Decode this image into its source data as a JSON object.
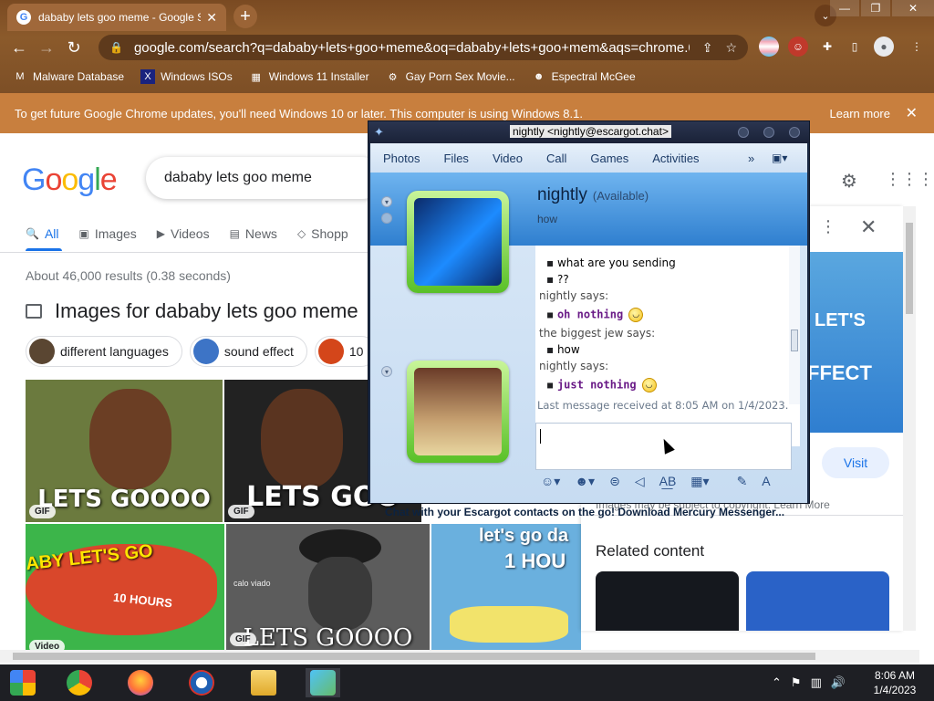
{
  "browser": {
    "tab_title": "dababy lets goo meme - Google Se",
    "url": "google.com/search?q=dababy+lets+goo+meme&oq=dababy+lets+goo+mem&aqs=chrome.0.0i51...",
    "bookmarks": [
      {
        "label": "Malware Database",
        "icon": "M"
      },
      {
        "label": "Windows ISOs",
        "icon": "X"
      },
      {
        "label": "Windows 11 Installer",
        "icon": "▦"
      },
      {
        "label": "Gay Porn Sex Movie...",
        "icon": "⚙"
      },
      {
        "label": "Espectral McGee",
        "icon": "☻"
      }
    ],
    "infobar_text": "To get future Google Chrome updates, you'll need Windows 10 or later. This computer is using Windows 8.1.",
    "infobar_link": "Learn more"
  },
  "google": {
    "logo": [
      "G",
      "o",
      "o",
      "g",
      "l",
      "e"
    ],
    "query": "dababy lets goo meme",
    "tabs": [
      {
        "label": "All",
        "icon": "🔍"
      },
      {
        "label": "Images",
        "icon": "▣"
      },
      {
        "label": "Videos",
        "icon": "▶"
      },
      {
        "label": "News",
        "icon": "▤"
      },
      {
        "label": "Shopp",
        "icon": "◇"
      }
    ],
    "stats": "About 46,000 results (0.38 seconds)",
    "images_heading": "Images for dababy lets goo meme",
    "chips": [
      "different languages",
      "sound effect",
      "10"
    ],
    "image_captions": [
      "LETS GOOOO",
      "LETS GOO",
      "ABY LET'S GO",
      "10 HOURS",
      "LETS GOOOO",
      "let's go da",
      "1 HOU",
      "calo viado"
    ],
    "gif_label": "GIF",
    "video_label": "Video",
    "panel": {
      "banner_line1": "LET'S",
      "banner_line2": "FFECT",
      "visit": "Visit",
      "note": "Images may be subject to copyright. Learn More",
      "related": "Related content"
    }
  },
  "escargot": {
    "title": "nightly <nightly@escargot.chat>",
    "menu": [
      "Photos",
      "Files",
      "Video",
      "Call",
      "Games",
      "Activities"
    ],
    "more": "»",
    "contact_name": "nightly",
    "contact_status": "(Available)",
    "personal_message": "how",
    "conversation": [
      {
        "type": "msg",
        "text": "what are you sending",
        "style": "plain"
      },
      {
        "type": "msg",
        "text": "??",
        "style": "plain"
      },
      {
        "type": "says",
        "text": "nightly says:"
      },
      {
        "type": "msg",
        "text": "oh nothing",
        "style": "mine",
        "smiley": true
      },
      {
        "type": "says",
        "text": "the biggest jew says:"
      },
      {
        "type": "msg",
        "text": "how",
        "style": "plain"
      },
      {
        "type": "says",
        "text": "nightly says:"
      },
      {
        "type": "msg",
        "text": "just nothing",
        "style": "mine",
        "smiley": true
      }
    ],
    "last_received": "Last message received at 8:05 AM on 1/4/2023.",
    "footer": "Chat with your Escargot contacts on the go! Download Mercury Messenger..."
  },
  "taskbar": {
    "time": "8:06 AM",
    "date": "1/4/2023"
  },
  "colors": {
    "chrome_brown": "#8b5a2b",
    "google_blue": "#4285f4",
    "google_red": "#ea4335",
    "google_yellow": "#fbbc05",
    "google_green": "#34a853",
    "escargot_blue": "#2f7fcf",
    "taskbar": "#1e1f24"
  }
}
